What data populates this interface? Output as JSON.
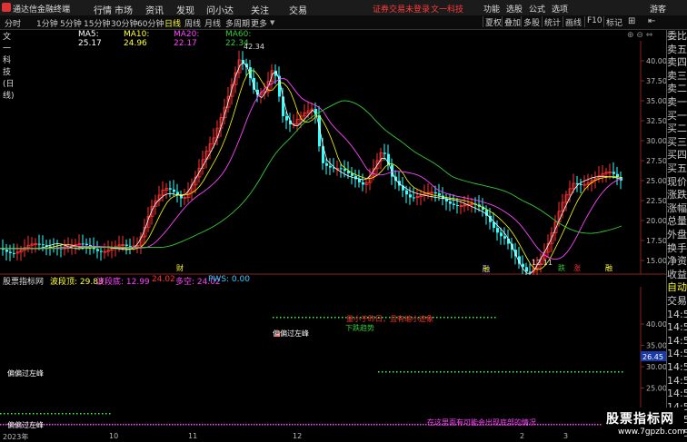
{
  "app": {
    "name": "通达信金融终端",
    "login_text": "证券交易未登录",
    "stock_link": "文一科技"
  },
  "menu": [
    "行情",
    "市场",
    "资讯",
    "发现",
    "问小达",
    "关注",
    "交易"
  ],
  "right_menu": [
    "功能",
    "选股",
    "公式",
    "选项",
    "游客"
  ],
  "toolbar": {
    "periods": [
      "分时",
      "1分钟",
      "5分钟",
      "15分钟",
      "30分钟",
      "60分钟",
      "日线",
      "周线",
      "月线",
      "多周期",
      "更多"
    ],
    "active": "日线",
    "right_buttons": [
      "叠加",
      "统计",
      "画线",
      "F10",
      "标记"
    ],
    "right_extra": [
      "夏权",
      "多股"
    ]
  },
  "legend": {
    "title": "文一科技(日线)",
    "ma5": "MA5: 25.17",
    "ma10": "MA10: 24.96",
    "ma20": "MA20: 22.17",
    "ma60": "MA60: 22.34",
    "colors": {
      "ma5": "#ffffff",
      "ma10": "#ffff00",
      "ma20": "#ff44ff",
      "ma60": "#33cc33"
    }
  },
  "price_axis": [
    "40.00",
    "37.50",
    "35.00",
    "32.50",
    "30.00",
    "27.50",
    "25.00",
    "22.50",
    "20.00",
    "17.50",
    "15.00"
  ],
  "annotations": {
    "high": "42.34",
    "low": "12.11"
  },
  "markers": [
    "财",
    "融",
    "跌",
    "涨",
    "融"
  ],
  "indicator": {
    "title": "股票指标网",
    "wbd": "波段顶: 29.83",
    "wbl": "波段底: 12.99",
    "v3": "24.02",
    "dk": "多空: 24.02",
    "pws": "PWS: 0.00",
    "axis": [
      "40.00",
      "35.00",
      "30.00",
      "25.00"
    ],
    "current": "26.45",
    "note_red": "量小于昨日，且有缩小迹象",
    "note_green": "下跌趋势",
    "note_white": "偏偏过左峰",
    "note_white2": "偏偏过左峰",
    "note_bottom": "在这里面有可能会出现底部的情况"
  },
  "sidebar_items": [
    "委比",
    "卖五",
    "卖四",
    "卖三",
    "卖二",
    "卖一",
    "买一",
    "买二",
    "买三",
    "买四",
    "买五",
    "现价",
    "涨跌",
    "涨幅",
    "总量",
    "外盘",
    "换手",
    "净资",
    "收益",
    "自动",
    "交易",
    "14:5",
    "14:5",
    "14:5",
    "14:5",
    "14:5",
    "14:5",
    "14:5",
    "14:5",
    "14:5",
    "14:5"
  ],
  "dates": {
    "year": "2023年",
    "d1": "10",
    "d2": "11",
    "d3": "12",
    "d4": "2",
    "d5": "3"
  },
  "watermark": {
    "main": "股票指标网",
    "sub": "www.7gpzb.com"
  }
}
